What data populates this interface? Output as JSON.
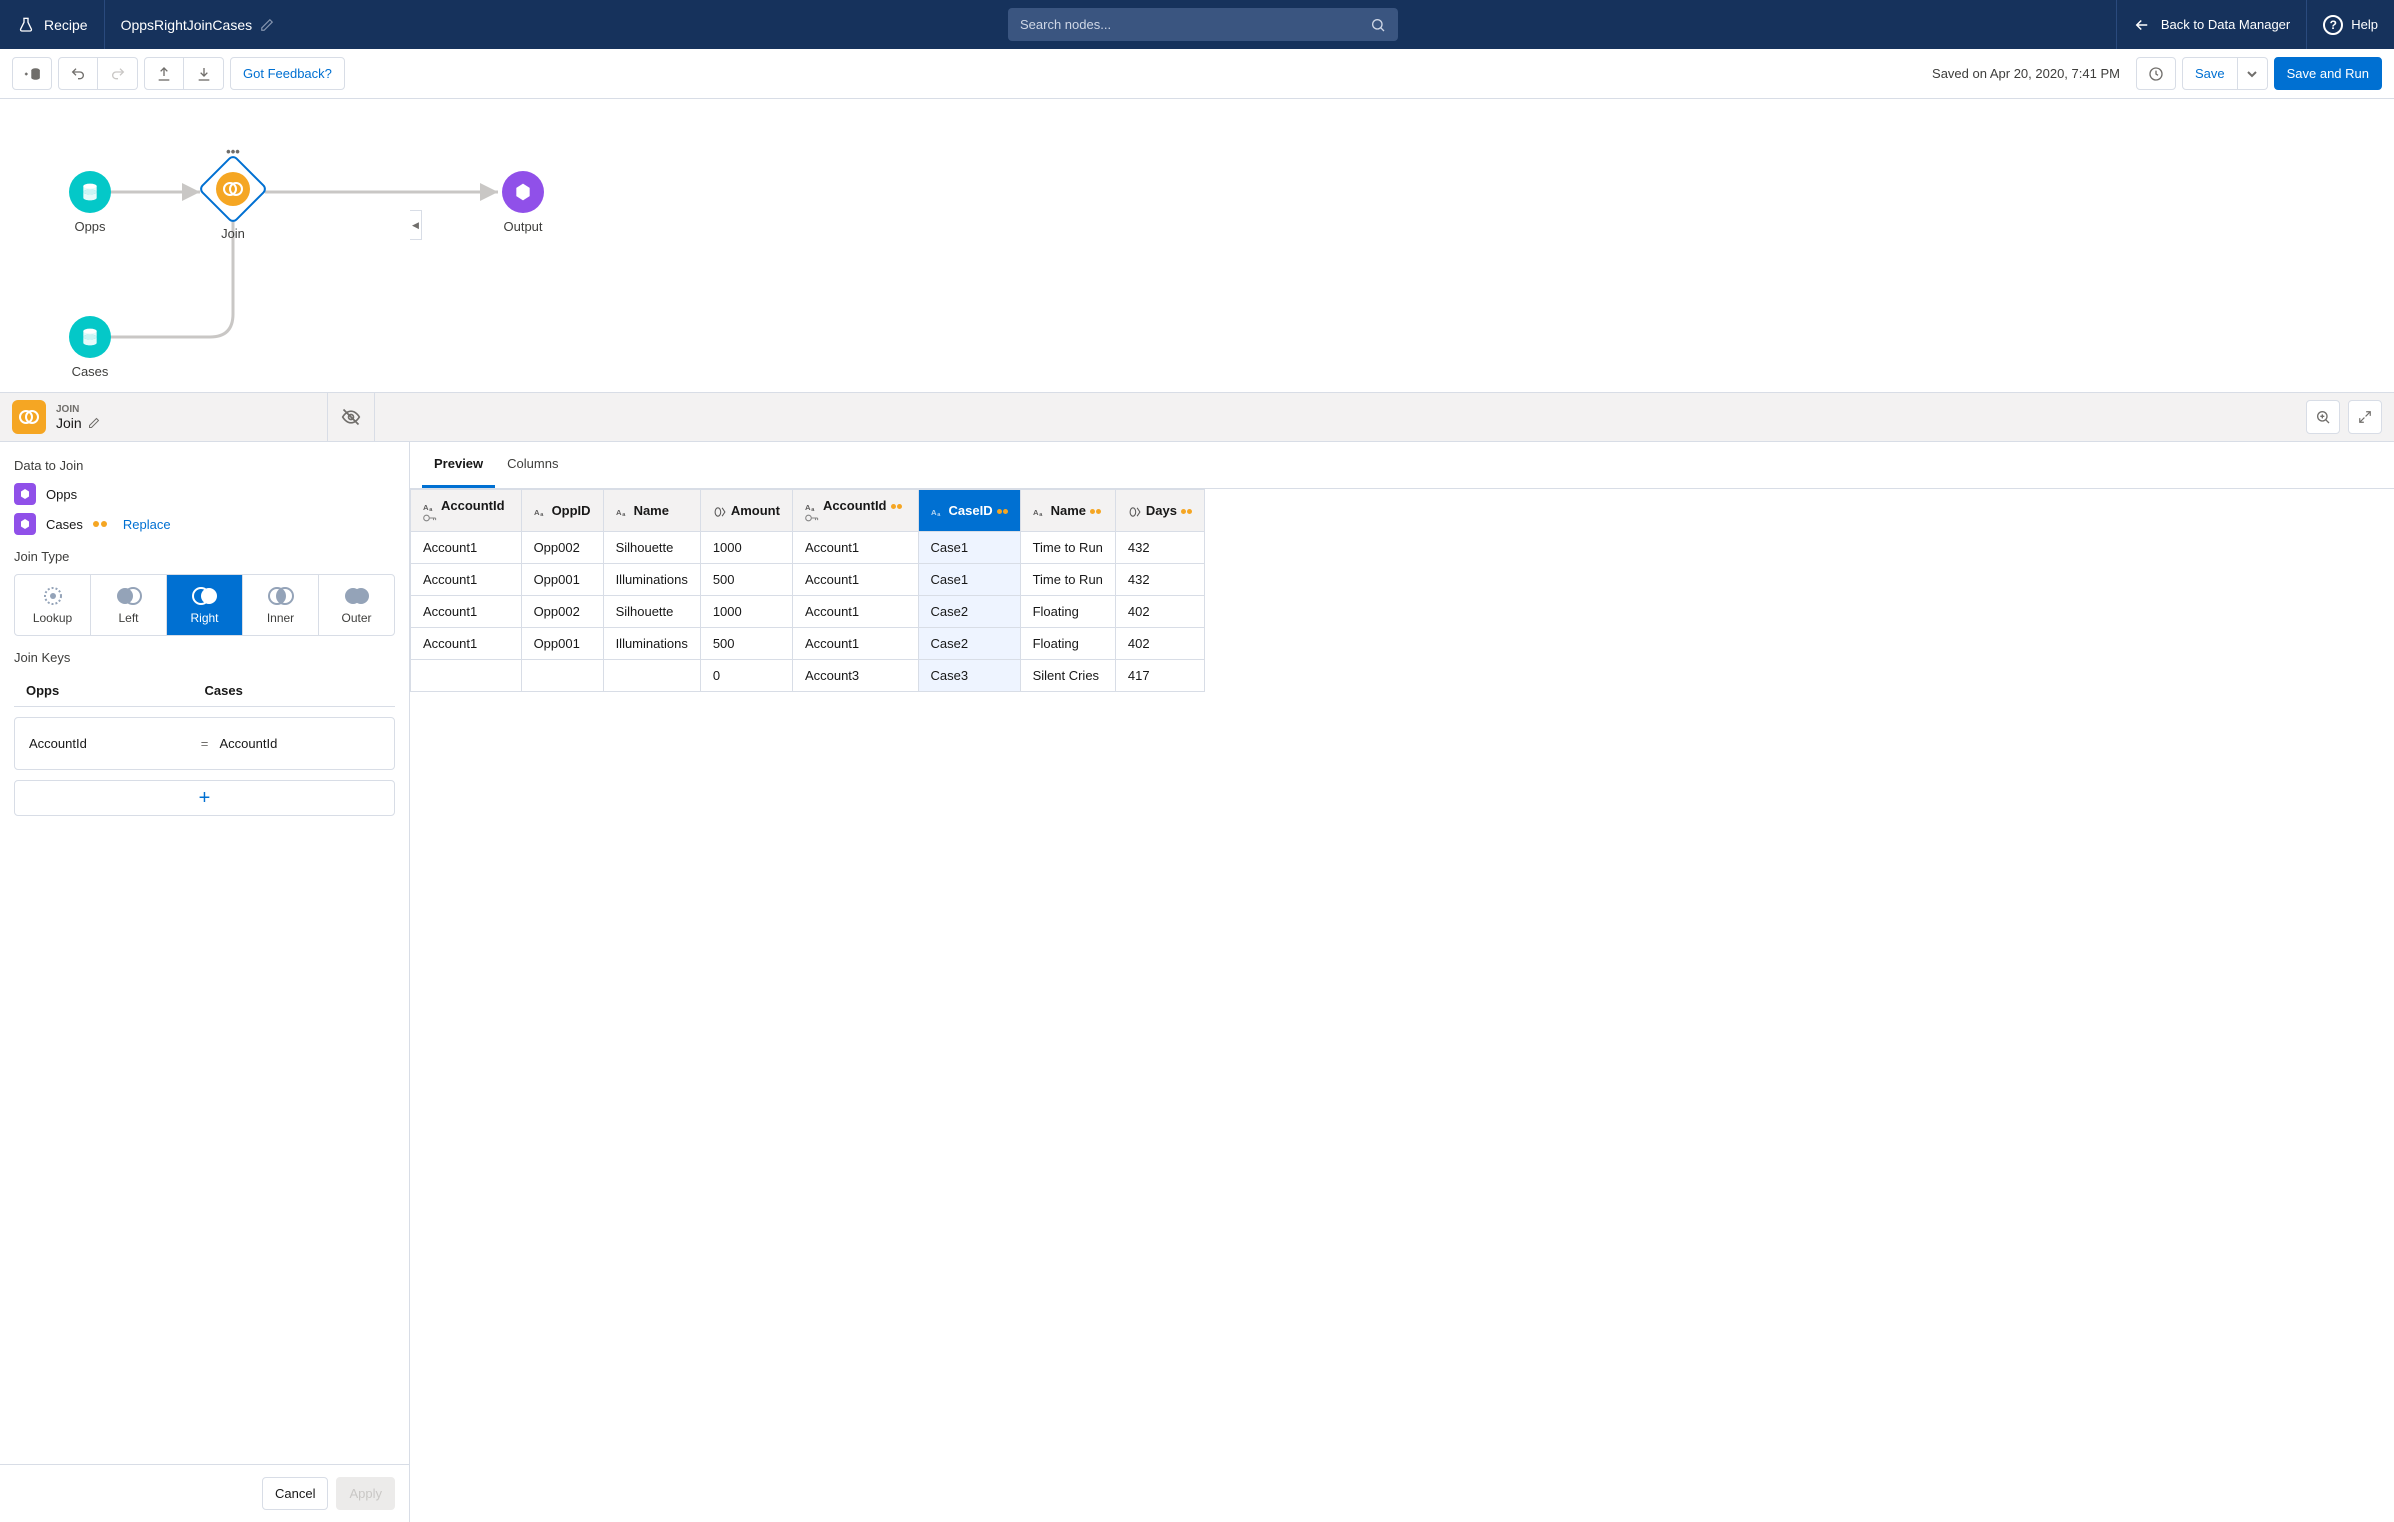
{
  "topnav": {
    "recipe_label": "Recipe",
    "recipe_name": "OppsRightJoinCases",
    "search_placeholder": "Search nodes...",
    "back_label": "Back to Data Manager",
    "help_label": "Help"
  },
  "toolbar": {
    "feedback_label": "Got Feedback?",
    "saved_text": "Saved on Apr 20, 2020, 7:41 PM",
    "save_label": "Save",
    "save_run_label": "Save and Run"
  },
  "canvas": {
    "node_opps": "Opps",
    "node_join": "Join",
    "node_output": "Output",
    "node_cases": "Cases"
  },
  "panel": {
    "eyebrow": "JOIN",
    "name": "Join"
  },
  "side": {
    "data_to_join_label": "Data to Join",
    "ds1": "Opps",
    "ds2": "Cases",
    "replace_label": "Replace",
    "join_type_label": "Join Type",
    "jt_lookup": "Lookup",
    "jt_left": "Left",
    "jt_right": "Right",
    "jt_inner": "Inner",
    "jt_outer": "Outer",
    "join_keys_label": "Join Keys",
    "keys_left_header": "Opps",
    "keys_right_header": "Cases",
    "key_left": "AccountId",
    "key_eq": "=",
    "key_right": "AccountId",
    "cancel_label": "Cancel",
    "apply_label": "Apply"
  },
  "tabs": {
    "preview": "Preview",
    "columns": "Columns"
  },
  "columns": [
    {
      "name": "AccountId",
      "type": "text",
      "key": true
    },
    {
      "name": "OppID",
      "type": "text"
    },
    {
      "name": "Name",
      "type": "text"
    },
    {
      "name": "Amount",
      "type": "number"
    },
    {
      "name": "AccountId",
      "type": "text",
      "linked": true,
      "key": true
    },
    {
      "name": "CaseID",
      "type": "text",
      "linked": true,
      "selected": true
    },
    {
      "name": "Name",
      "type": "text",
      "linked": true
    },
    {
      "name": "Days",
      "type": "number",
      "linked": true
    }
  ],
  "rows": [
    [
      "Account1",
      "Opp002",
      "Silhouette",
      "1000",
      "Account1",
      "Case1",
      "Time to Run",
      "432"
    ],
    [
      "Account1",
      "Opp001",
      "Illuminations",
      "500",
      "Account1",
      "Case1",
      "Time to Run",
      "432"
    ],
    [
      "Account1",
      "Opp002",
      "Silhouette",
      "1000",
      "Account1",
      "Case2",
      "Floating",
      "402"
    ],
    [
      "Account1",
      "Opp001",
      "Illuminations",
      "500",
      "Account1",
      "Case2",
      "Floating",
      "402"
    ],
    [
      "",
      "",
      "",
      "0",
      "Account3",
      "Case3",
      "Silent Cries",
      "417"
    ]
  ]
}
